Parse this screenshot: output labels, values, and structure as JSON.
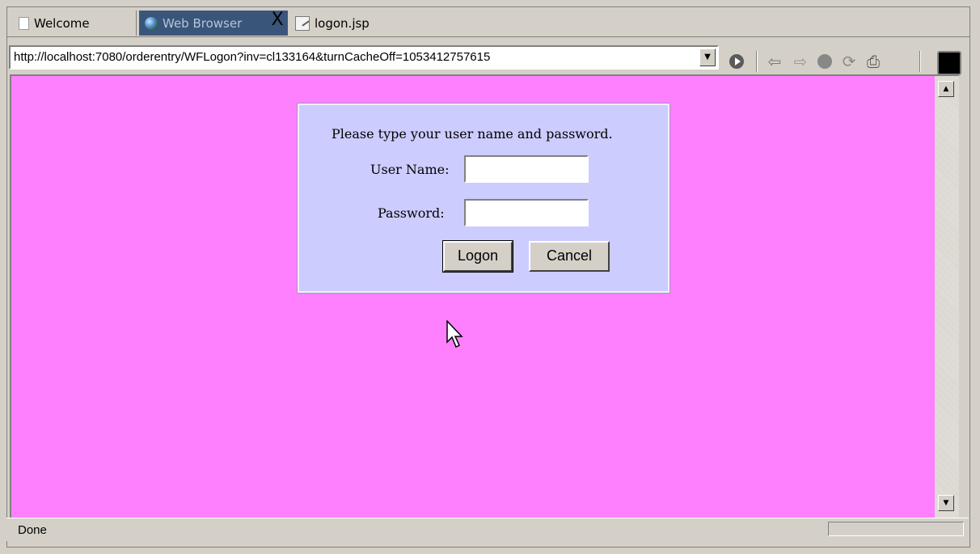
{
  "tabs": [
    {
      "label": "Welcome",
      "icon": "document-icon"
    },
    {
      "label": "Web Browser",
      "icon": "globe-icon",
      "active": true
    },
    {
      "label": "logon.jsp",
      "icon": "jsp-file-icon"
    }
  ],
  "close_glyph": "X",
  "address": {
    "url": "http://localhost:7080/orderentry/WFLogon?inv=cl133164&turnCacheOff=1053412757615"
  },
  "toolbar": {
    "icons": [
      "go-icon",
      "back-icon",
      "forward-icon",
      "stop-icon",
      "refresh-icon",
      "print-icon"
    ]
  },
  "page": {
    "background": "#ff80ff",
    "login": {
      "background": "#ccccff",
      "prompt": "Please type your user name and password.",
      "username_label": "User Name:",
      "username_value": "",
      "password_label": "Password:",
      "password_value": "",
      "logon_button": "Logon",
      "cancel_button": "Cancel"
    }
  },
  "status": {
    "text": "Done"
  }
}
